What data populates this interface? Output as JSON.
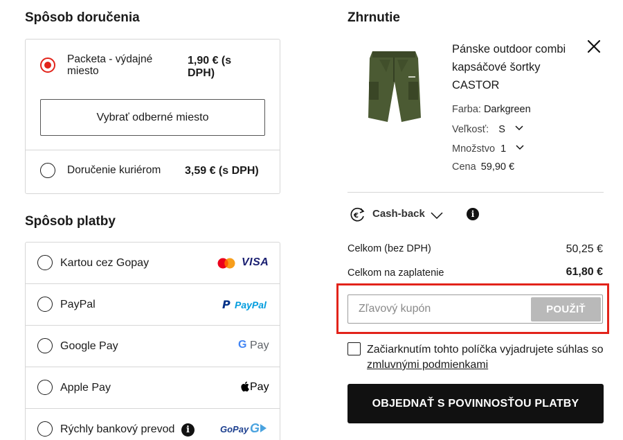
{
  "delivery": {
    "title": "Spôsob doručenia",
    "options": [
      {
        "label_line1": "Packeta - výdajné",
        "label_line2": "miesto",
        "price_line1": "1,90 € (s",
        "price_line2": "DPH)",
        "selected": true
      },
      {
        "label": "Doručenie kuriérom",
        "price": "3,59 € (s DPH)",
        "selected": false
      }
    ],
    "pickup_button": "Vybrať odberné miesto"
  },
  "payment": {
    "title": "Spôsob platby",
    "options": [
      {
        "label": "Kartou cez Gopay",
        "logo_icons": [
          "mastercard-icon",
          "visa-logo"
        ],
        "logo_text": "VISA"
      },
      {
        "label": "PayPal",
        "logo_icons": [
          "paypal-logo"
        ],
        "logo_text": "PayPal"
      },
      {
        "label": "Google Pay",
        "logo_icons": [
          "google-pay-logo"
        ],
        "logo_text": "Pay"
      },
      {
        "label": "Apple Pay",
        "logo_icons": [
          "apple-pay-logo"
        ],
        "logo_text": "Pay"
      },
      {
        "label": "Rýchly bankový prevod",
        "logo_icons": [
          "gopay-logo",
          "info-icon"
        ],
        "logo_text": "GoPay"
      }
    ]
  },
  "summary": {
    "title": "Zhrnutie",
    "product": {
      "name": "Pánske outdoor combi kapsáčové šortky CASTOR",
      "color_label": "Farba:",
      "color_value": "Darkgreen",
      "size_label": "Veľkosť:",
      "size_value": "S",
      "qty_label": "Množstvo",
      "qty_value": "1",
      "price_label": "Cena",
      "price_value": "59,90 €"
    },
    "cashback_label": "Cash-back",
    "total_ex_vat_label": "Celkom (bez DPH)",
    "total_ex_vat_value": "50,25 €",
    "total_label": "Celkom na zaplatenie",
    "total_value": "61,80 €",
    "coupon_placeholder": "Zľavový kupón",
    "coupon_button": "POUŽIŤ",
    "consent_text": "Začiarknutím tohto políčka vyjadrujete súhlas so",
    "consent_link": "zmluvnými podmienkami",
    "order_button": "OBJEDNAŤ S POVINNOSŤOU PLATBY"
  },
  "colors": {
    "accent": "#e2231a",
    "dark": "#111111",
    "border": "#d6d6d6",
    "disabled_button": "#b9b9b9"
  }
}
